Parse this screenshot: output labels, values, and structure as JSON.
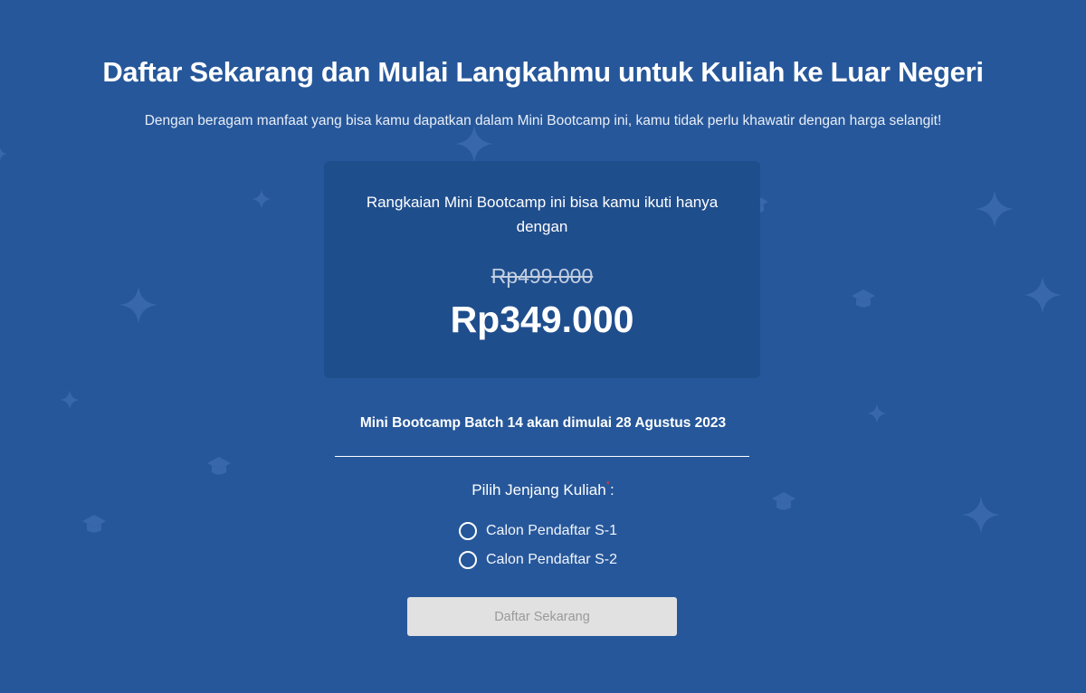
{
  "header": {
    "title": "Daftar Sekarang dan Mulai Langkahmu untuk Kuliah ke Luar Negeri",
    "subtitle": "Dengan beragam manfaat yang bisa kamu dapatkan dalam Mini Bootcamp ini, kamu tidak perlu khawatir dengan harga selangit!"
  },
  "pricing": {
    "intro": "Rangkaian Mini Bootcamp ini bisa kamu ikuti hanya dengan",
    "original_price": "Rp499.000",
    "discount_price": "Rp349.000"
  },
  "batch": {
    "info": "Mini Bootcamp Batch 14 akan dimulai 28 Agustus 2023"
  },
  "form": {
    "level_label": "Pilih Jenjang Kuliah",
    "required_mark": "*",
    "level_suffix": ":",
    "options": [
      {
        "label": "Calon Pendaftar S-1",
        "selected": false
      },
      {
        "label": "Calon Pendaftar S-2",
        "selected": false
      }
    ],
    "submit_label": "Daftar Sekarang",
    "submit_disabled": true
  },
  "colors": {
    "background": "#26579a",
    "card": "#1f4e8d",
    "button_disabled": "#e1e1e1",
    "required": "#e53935"
  },
  "decorations": {
    "icons": [
      "sparkle-icon",
      "graduation-cap-icon"
    ]
  }
}
